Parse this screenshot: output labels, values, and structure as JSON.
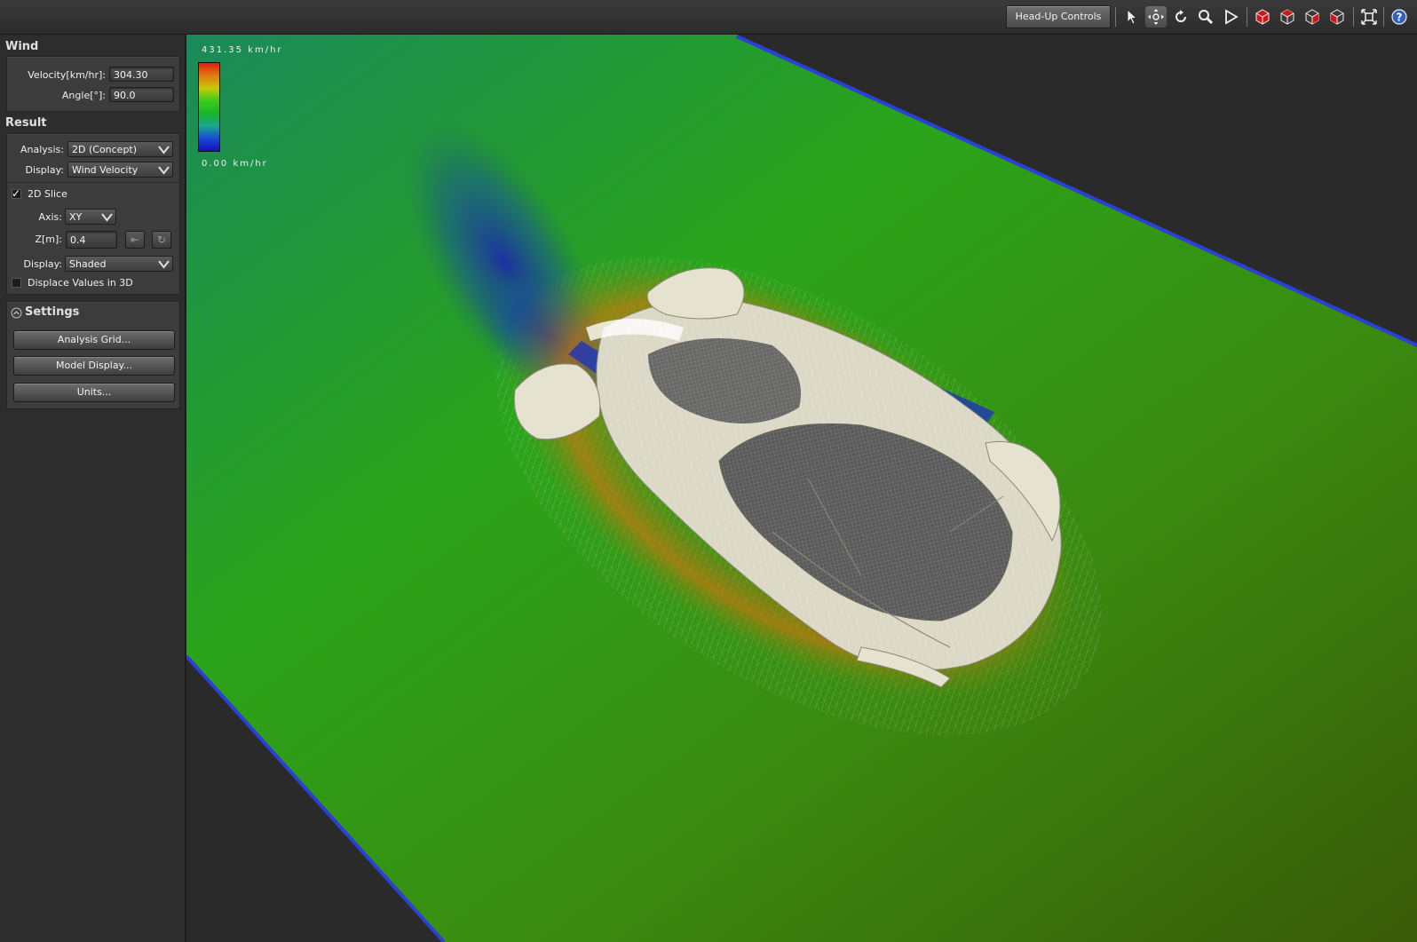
{
  "toolbar": {
    "hud_label": "Head-Up Controls",
    "icons": [
      "select-arrow-icon",
      "pan-icon",
      "rotate-icon",
      "zoom-icon",
      "play-icon",
      "view-cube-icon",
      "view-cube-icon",
      "view-cube-icon",
      "view-cube-icon",
      "fit-view-icon",
      "help-icon"
    ]
  },
  "wind": {
    "header": "Wind",
    "velocity_label": "Velocity[km/hr]:",
    "velocity_value": "304.30",
    "angle_label": "Angle[°]:",
    "angle_value": "90.0"
  },
  "result": {
    "header": "Result",
    "analysis_label": "Analysis:",
    "analysis_value": "2D (Concept)",
    "display_label": "Display:",
    "display_value": "Wind Velocity",
    "slice_label": "2D Slice",
    "slice_checked": true,
    "axis_label": "Axis:",
    "axis_value": "XY",
    "z_label": "Z[m]:",
    "z_value": "0.4",
    "display2_label": "Display:",
    "display2_value": "Shaded",
    "displace_label": "Displace Values in 3D",
    "displace_checked": false
  },
  "settings": {
    "header": "Settings",
    "buttons": [
      "Analysis Grid...",
      "Model Display...",
      "Units..."
    ]
  },
  "legend": {
    "max": "431.35 km/hr",
    "min": "0.00 km/hr"
  },
  "colors": {
    "high": "#e02010",
    "mid": "#3ccc1c",
    "low": "#1410b8",
    "ground": "#3a7a10"
  }
}
